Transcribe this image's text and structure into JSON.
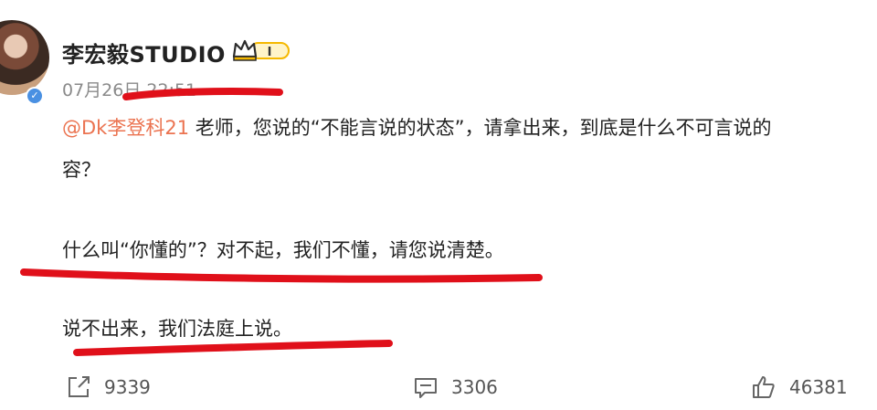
{
  "author": {
    "name": "李宏毅STUDIO",
    "vip_label": "I"
  },
  "post": {
    "timestamp": "07月26日 22:51",
    "mention": "@Dk李登科21",
    "line1_text": " 老师，您说的“不能言说的状态”，请拿出来，到底是什么不可言说的",
    "line2_text": "容？",
    "line3_text": "什么叫“你懂的”？对不起，我们不懂，请您说清楚。",
    "line4_text": "说不出来，我们法庭上说。"
  },
  "actions": {
    "repost_count": "9339",
    "comment_count": "3306",
    "like_count": "46381"
  },
  "colors": {
    "mention": "#eb7350",
    "underline": "#e0101a",
    "verified": "#4a90e2",
    "vip": "#f5b800"
  }
}
